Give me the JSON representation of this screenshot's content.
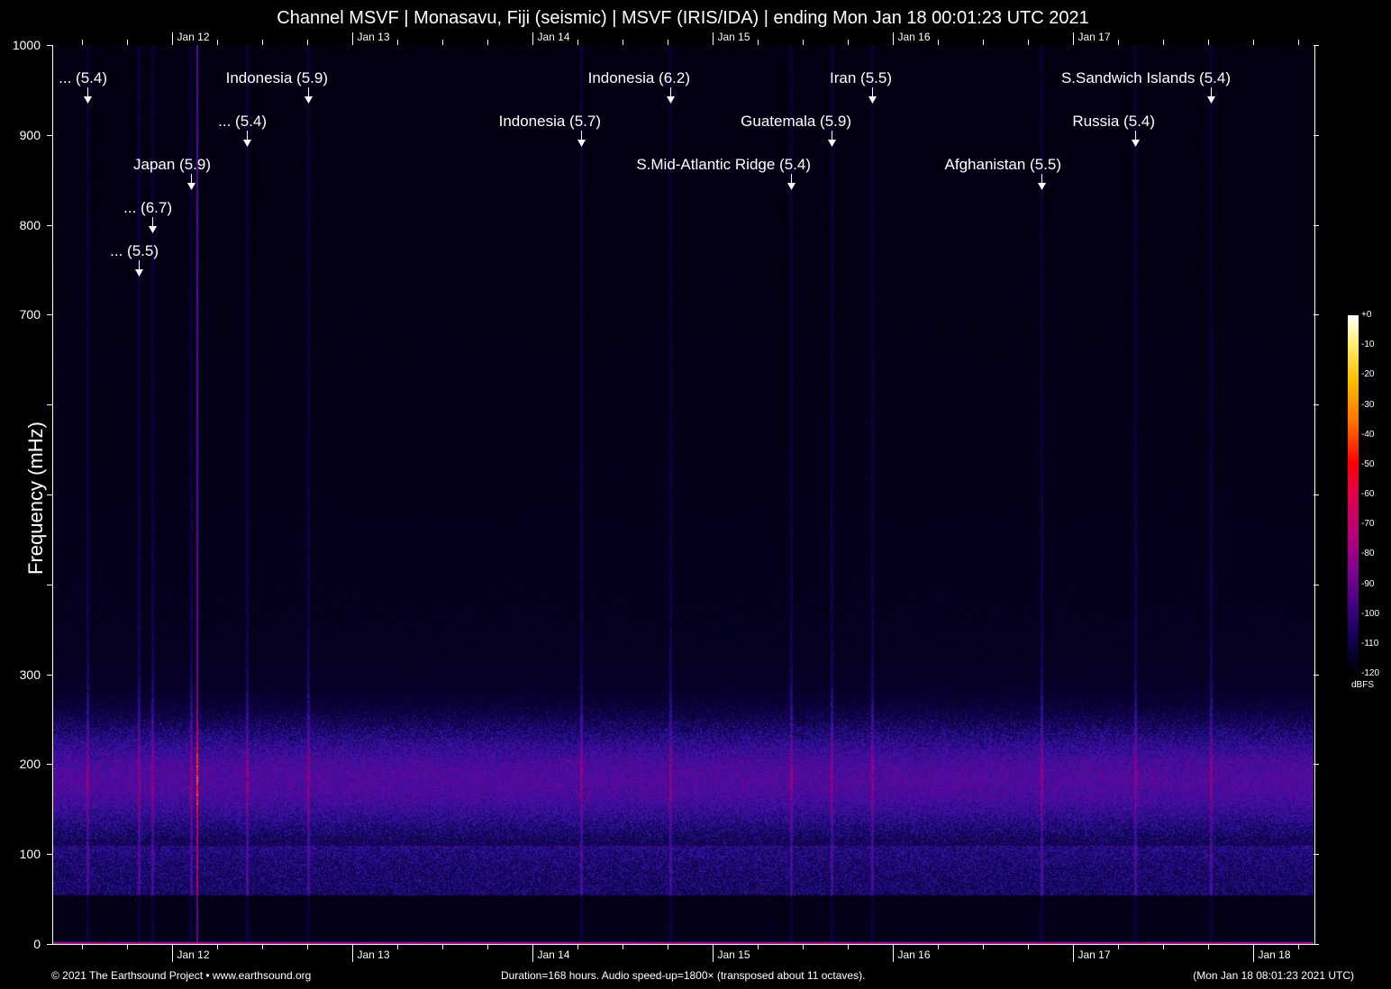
{
  "title": "Channel MSVF | Monasavu, Fiji (seismic) | MSVF (IRIS/IDA) | ending Mon Jan 18 00:01:23 UTC 2021",
  "footer": {
    "left": "© 2021 The Earthsound Project • www.earthsound.org",
    "center": "Duration=168 hours. Audio speed-up=1800× (transposed about 11 octaves).",
    "right": "(Mon Jan 18 08:01:23 2021 UTC)"
  },
  "chart_data": {
    "type": "heatmap",
    "title": "Channel MSVF | Monasavu, Fiji (seismic) | MSVF (IRIS/IDA) | ending Mon Jan 18 00:01:23 UTC 2021",
    "ylabel": "Frequency (mHz)",
    "ylim": [
      0,
      1000
    ],
    "y_ticks": [
      0,
      100,
      200,
      300,
      400,
      500,
      600,
      700,
      800,
      900,
      1000
    ],
    "y_tick_labels": [
      "0",
      "100",
      "200",
      "300",
      "",
      "",
      "",
      "700",
      "800",
      "900",
      "1000"
    ],
    "duration_hours": 168,
    "start_offset_hours_to_first_day": 15.98,
    "x_tick_labels_bottom": [
      "Jan 12",
      "Jan 13",
      "Jan 14",
      "Jan 15",
      "Jan 16",
      "Jan 17",
      "Jan 18"
    ],
    "x_tick_labels_top": [
      "Jan 12",
      "Jan 13",
      "Jan 14",
      "Jan 15",
      "Jan 16",
      "Jan 17"
    ],
    "colorbar": {
      "label": "dBFS",
      "range": [
        -120,
        0
      ],
      "ticks": [
        "+0",
        "-10",
        "-20",
        "-30",
        "-40",
        "-50",
        "-60",
        "-70",
        "-80",
        "-90",
        "-100",
        "-110",
        "-120"
      ]
    },
    "events": [
      {
        "label": "... (5.4)",
        "hours": 4.7
      },
      {
        "label": "Indonesia (5.9)",
        "hours": 34.1
      },
      {
        "label": "... (5.4)",
        "hours": 25.9
      },
      {
        "label": "Japan (5.9)",
        "hours": 18.5
      },
      {
        "label": "... (6.7)",
        "hours": 13.3
      },
      {
        "label": "... (5.5)",
        "hours": 11.5
      },
      {
        "label": "Indonesia (6.2)",
        "hours": 82.3
      },
      {
        "label": "Indonesia (5.7)",
        "hours": 70.4
      },
      {
        "label": "Iran (5.5)",
        "hours": 109.2
      },
      {
        "label": "Guatemala (5.9)",
        "hours": 103.8
      },
      {
        "label": "S.Mid-Atlantic Ridge (5.4)",
        "hours": 98.4
      },
      {
        "label": "Afghanistan (5.5)",
        "hours": 131.8
      },
      {
        "label": "S.Sandwich Islands (5.4)",
        "hours": 154.3
      },
      {
        "label": "Russia (5.4)",
        "hours": 144.2
      }
    ]
  }
}
